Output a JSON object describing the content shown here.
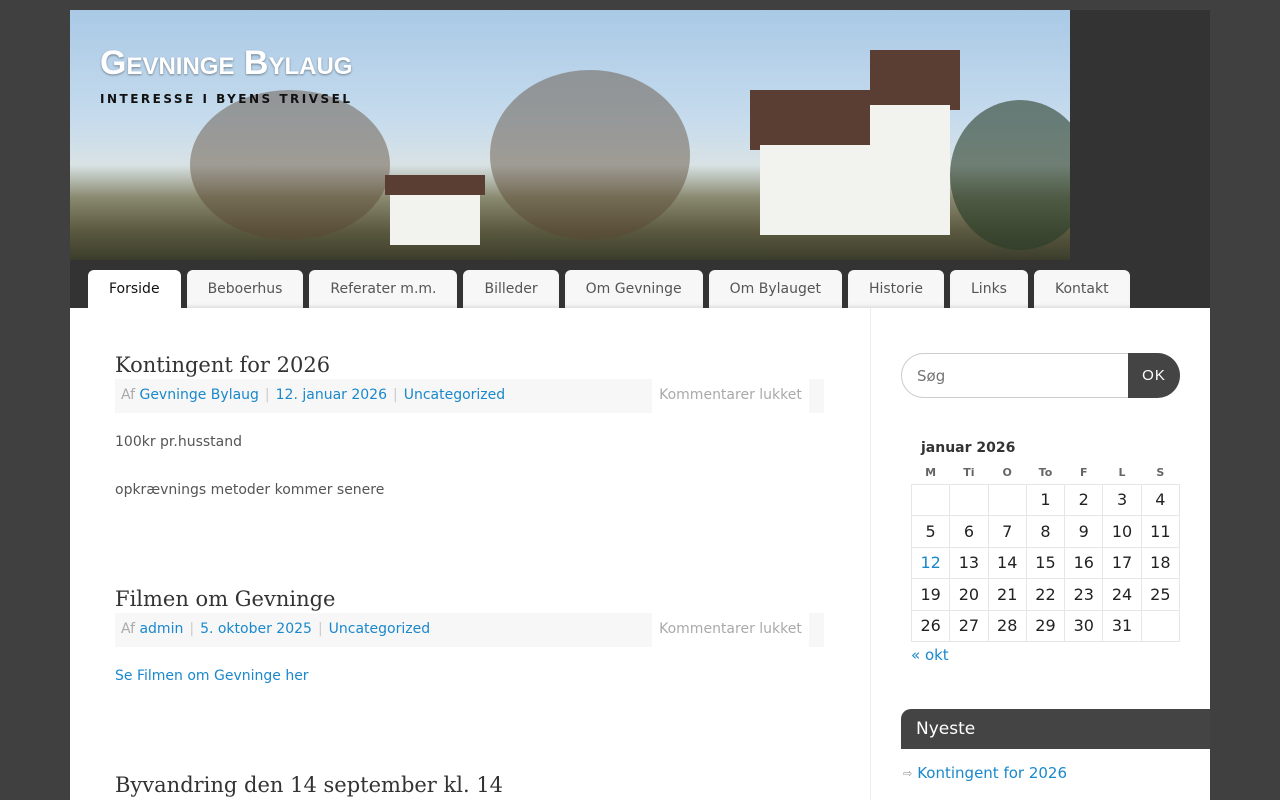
{
  "site": {
    "title": "Gevninge Bylaug",
    "tagline": "INTERESSE I BYENS TRIVSEL"
  },
  "nav": [
    "Forside",
    "Beboerhus",
    "Referater m.m.",
    "Billeder",
    "Om Gevninge",
    "Om Bylauget",
    "Historie",
    "Links",
    "Kontakt"
  ],
  "posts": [
    {
      "title": "Kontingent for 2026",
      "by": "Af",
      "author": "Gevninge Bylaug",
      "date": "12. januar 2026",
      "category": "Uncategorized",
      "comments": "Kommentarer lukket",
      "paragraphs": [
        "100kr pr.husstand",
        "opkrævnings metoder kommer senere"
      ]
    },
    {
      "title": "Filmen om Gevninge",
      "by": "Af",
      "author": "admin",
      "date": "5. oktober 2025",
      "category": "Uncategorized",
      "comments": "Kommentarer lukket",
      "link": "Se Filmen om Gevninge her"
    },
    {
      "title": "Byvandring den 14 september kl. 14"
    }
  ],
  "search": {
    "placeholder": "Søg",
    "button": "OK"
  },
  "calendar": {
    "caption": "januar 2026",
    "days": [
      "M",
      "Ti",
      "O",
      "To",
      "F",
      "L",
      "S"
    ],
    "weeks": [
      [
        "",
        "",
        "",
        "1",
        "2",
        "3",
        "4"
      ],
      [
        "5",
        "6",
        "7",
        "8",
        "9",
        "10",
        "11"
      ],
      [
        "12",
        "13",
        "14",
        "15",
        "16",
        "17",
        "18"
      ],
      [
        "19",
        "20",
        "21",
        "22",
        "23",
        "24",
        "25"
      ],
      [
        "26",
        "27",
        "28",
        "29",
        "30",
        "31",
        ""
      ]
    ],
    "linked_day": "12",
    "prev": "« okt"
  },
  "recent": {
    "title": "Nyeste",
    "items": [
      "Kontingent for 2026"
    ]
  },
  "colors": {
    "link": "#1a88cc",
    "dark": "#444444"
  }
}
